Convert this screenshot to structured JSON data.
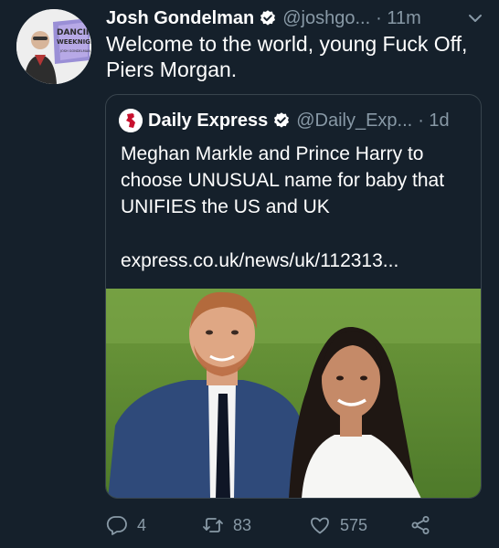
{
  "tweet": {
    "author_name": "Josh Gondelman",
    "handle": "@joshgo...",
    "time": "· 11m",
    "text": "Welcome to the world, young Fuck Off, Piers Morgan.",
    "avatar_text": [
      "DANCING",
      "WEEKNIGHT",
      "JOSH GONDELMAN"
    ]
  },
  "quote": {
    "author_name": "Daily Express",
    "handle": "@Daily_Exp...",
    "time": "· 1d",
    "text": "Meghan Markle and Prince Harry to choose UNUSUAL name for baby that UNIFIES the US and UK",
    "link": "express.co.uk/news/uk/112313..."
  },
  "actions": {
    "replies": "4",
    "retweets": "83",
    "likes": "575"
  },
  "colors": {
    "background": "#15202b",
    "muted": "#8899a6",
    "border": "#38444d",
    "verified": "#1da1f2"
  },
  "icons": [
    "verified-badge-icon",
    "chevron-down-icon",
    "reply-icon",
    "retweet-icon",
    "like-icon",
    "share-icon"
  ]
}
